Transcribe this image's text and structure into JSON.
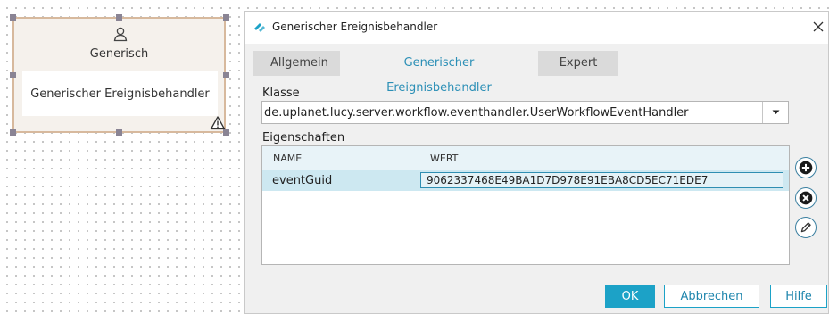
{
  "canvas": {
    "node": {
      "title": "Generisch",
      "body": "Generischer Ereignisbehandler",
      "icon": "user-icon",
      "status_icon": "warning-icon"
    }
  },
  "dialog": {
    "title": "Generischer Ereignisbehandler",
    "title_icon": "app-logo-icon",
    "tabs": [
      {
        "label": "Allgemein",
        "active": false
      },
      {
        "label": "Generischer Ereignisbehandler",
        "active": true
      },
      {
        "label": "Expert",
        "active": false
      }
    ],
    "class_label": "Klasse",
    "class_value": "de.uplanet.lucy.server.workflow.eventhandler.UserWorkflowEventHandler",
    "properties_label": "Eigenschaften",
    "table": {
      "columns": [
        "NAME",
        "WERT"
      ],
      "rows": [
        {
          "name": "eventGuid",
          "value": "9062337468E49BA1D7D978E91EBA8CD5EC71EDE7",
          "selected": true
        }
      ]
    },
    "side_actions": [
      "add-icon",
      "remove-icon",
      "edit-icon"
    ],
    "buttons": {
      "ok": "OK",
      "cancel": "Abbrechen",
      "help": "Hilfe"
    }
  },
  "colors": {
    "accent": "#1ca2c7",
    "active_tab_text": "#2b8fb6",
    "node_border": "#d7b99d",
    "selected_row": "#cde8f1"
  }
}
